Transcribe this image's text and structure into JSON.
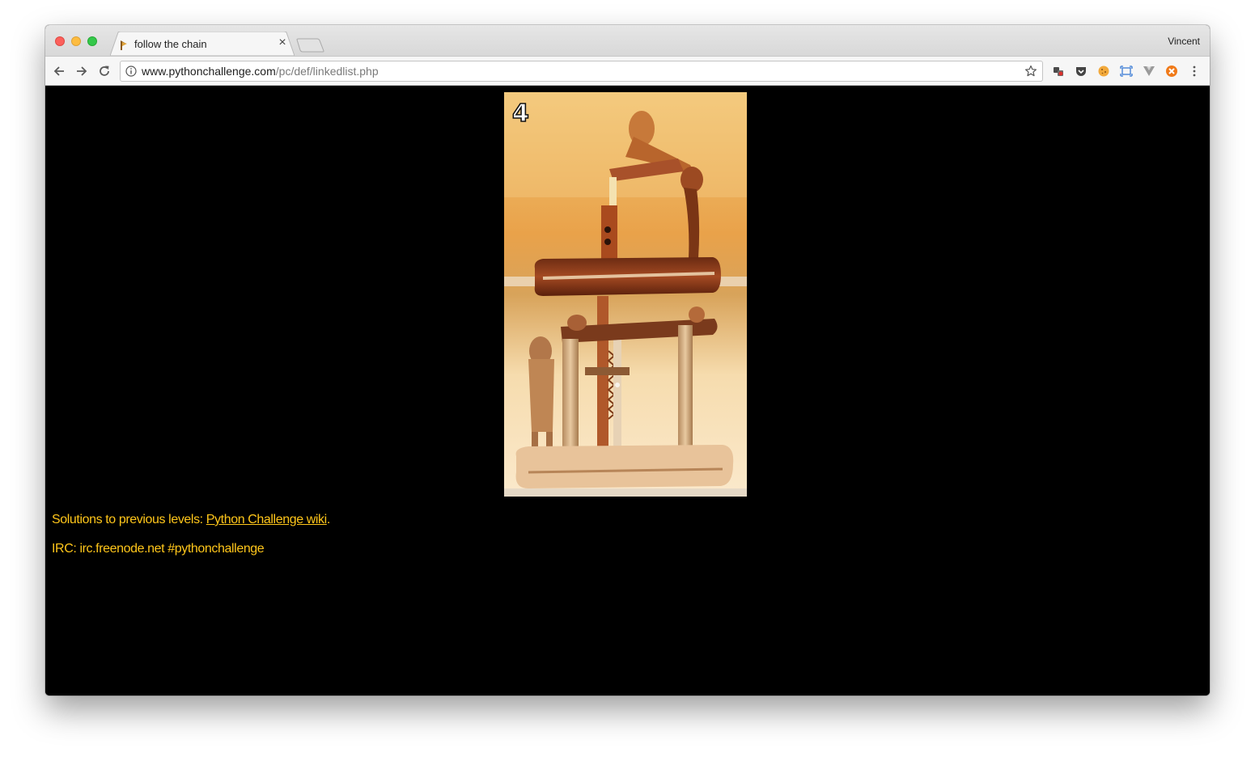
{
  "browser": {
    "tab": {
      "title": "follow the chain",
      "favicon": "python-challenge-favicon"
    },
    "profile_name": "Vincent",
    "url": {
      "host": "www.pythonchallenge.com",
      "path": "/pc/def/linkedlist.php"
    }
  },
  "page": {
    "image": {
      "number_label": "4",
      "description_icon": "wooden-sawing-figure-image"
    },
    "solutions": {
      "prefix": "Solutions to previous levels: ",
      "link": "Python Challenge wiki",
      "suffix": "."
    },
    "irc": "IRC: irc.freenode.net #pythonchallenge"
  },
  "colors": {
    "page_bg": "#000000",
    "text": "#ffc61a"
  }
}
